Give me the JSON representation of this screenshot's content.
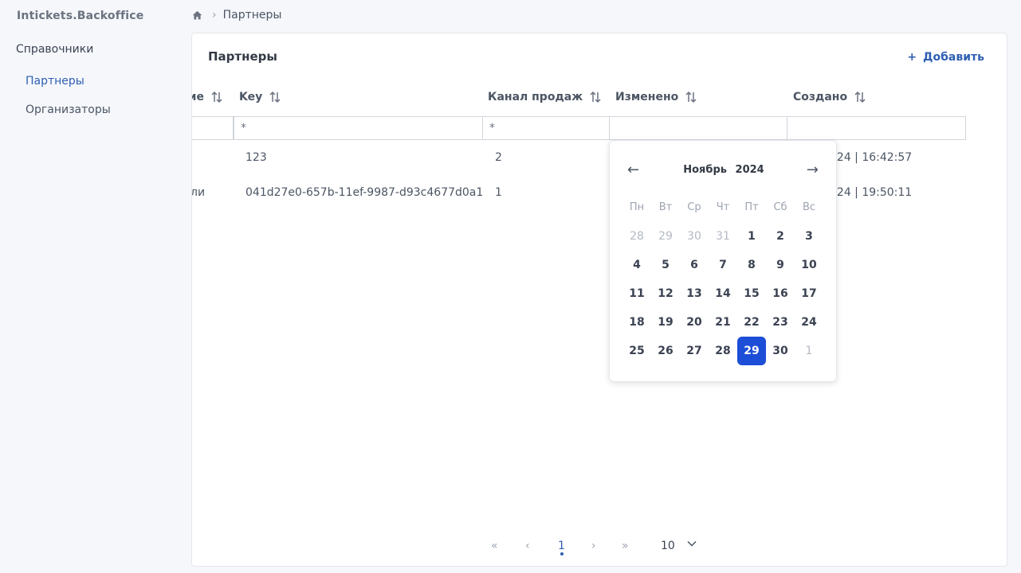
{
  "app": {
    "logo": "Intickets.Backoffice"
  },
  "sidebar": {
    "section_title": "Справочники",
    "items": [
      {
        "label": "Партнеры",
        "active": true
      },
      {
        "label": "Организаторы",
        "active": false
      }
    ]
  },
  "breadcrumb": {
    "home_icon": "home-icon",
    "current": "Партнеры"
  },
  "panel": {
    "title": "Партнеры",
    "add_button": {
      "icon": "+",
      "label": "Добавить"
    }
  },
  "table": {
    "columns": [
      {
        "label": "ние"
      },
      {
        "label": "Key"
      },
      {
        "label": "Канал продаж"
      },
      {
        "label": "Изменено"
      },
      {
        "label": "Создано"
      }
    ],
    "filters": [
      "",
      "*",
      "*",
      "",
      ""
    ],
    "rows": [
      {
        "name": "",
        "key": "123",
        "channel": "2",
        "created": "024 | 16:42:57"
      },
      {
        "name": "ли",
        "key": "041d27e0-657b-11ef-9987-d93c4677d0a1",
        "channel": "1",
        "created": "024 | 19:50:11"
      }
    ]
  },
  "pagination": {
    "first": "«",
    "prev": "‹",
    "current_page": "1",
    "next": "›",
    "last": "»",
    "page_size": "10",
    "page_size_icon": "chevron-down-icon"
  },
  "calendar": {
    "prev_icon": "←",
    "next_icon": "→",
    "month": "Ноябрь",
    "year": "2024",
    "weekdays": [
      "Пн",
      "Вт",
      "Ср",
      "Чт",
      "Пт",
      "Сб",
      "Вс"
    ],
    "days": [
      [
        "28",
        "29",
        "30",
        "31",
        "1",
        "2",
        "3"
      ],
      [
        "4",
        "5",
        "6",
        "7",
        "8",
        "9",
        "10"
      ],
      [
        "11",
        "12",
        "13",
        "14",
        "15",
        "16",
        "17"
      ],
      [
        "18",
        "19",
        "20",
        "21",
        "22",
        "23",
        "24"
      ],
      [
        "25",
        "26",
        "27",
        "28",
        "29",
        "30",
        "1"
      ]
    ],
    "selected_day": "29",
    "accent_color": "#1d4ed8"
  }
}
